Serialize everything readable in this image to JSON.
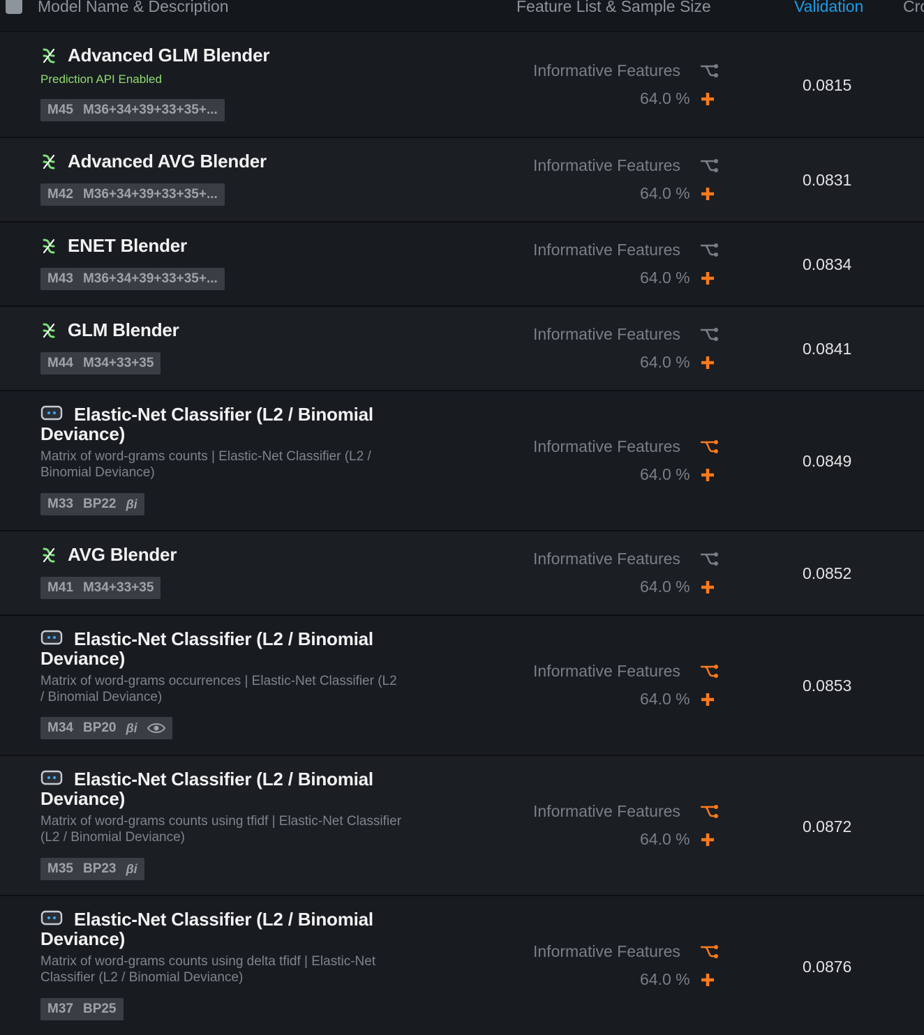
{
  "header": {
    "name_col": "Model Name & Description",
    "feature_col": "Feature List & Sample Size",
    "validation_col": "Validation",
    "cross_col": "Cro"
  },
  "colors": {
    "accent_blue": "#1e9be8",
    "accent_orange": "#ff7a1a",
    "api_green": "#8fdc6f",
    "blender_green": "#7ee07a"
  },
  "rows": [
    {
      "icon": "blender-icon",
      "title": "Advanced GLM Blender",
      "api": "Prediction API Enabled",
      "model_id": "M45",
      "blueprint": "M36+34+39+33+35+...",
      "feature_list": "Informative Features",
      "feature_icon_state": "gray",
      "sample": "64.0 %",
      "validation": "0.0815"
    },
    {
      "icon": "blender-icon",
      "title": "Advanced AVG Blender",
      "model_id": "M42",
      "blueprint": "M36+34+39+33+35+...",
      "feature_list": "Informative Features",
      "feature_icon_state": "gray",
      "sample": "64.0 %",
      "validation": "0.0831"
    },
    {
      "icon": "blender-icon",
      "title": "ENET Blender",
      "model_id": "M43",
      "blueprint": "M36+34+39+33+35+...",
      "feature_list": "Informative Features",
      "feature_icon_state": "gray",
      "sample": "64.0 %",
      "validation": "0.0834"
    },
    {
      "icon": "blender-icon",
      "title": "GLM Blender",
      "model_id": "M44",
      "blueprint": "M34+33+35",
      "feature_list": "Informative Features",
      "feature_icon_state": "gray",
      "sample": "64.0 %",
      "validation": "0.0841"
    },
    {
      "icon": "robot-icon",
      "title_line1": "Elastic-Net Classifier (L2 / Binomial",
      "title_line2": "Deviance)",
      "desc": "Matrix of word-grams counts | Elastic-Net Classifier (L2 / Binomial Deviance)",
      "model_id": "M33",
      "blueprint": "BP22",
      "beta": "βi",
      "feature_list": "Informative Features",
      "feature_icon_state": "orange",
      "sample": "64.0 %",
      "validation": "0.0849"
    },
    {
      "icon": "blender-icon",
      "title": "AVG Blender",
      "model_id": "M41",
      "blueprint": "M34+33+35",
      "feature_list": "Informative Features",
      "feature_icon_state": "gray",
      "sample": "64.0 %",
      "validation": "0.0852"
    },
    {
      "icon": "robot-icon",
      "title_line1": "Elastic-Net Classifier (L2 / Binomial",
      "title_line2": "Deviance)",
      "desc": "Matrix of word-grams occurrences | Elastic-Net Classifier (L2 / Binomial Deviance)",
      "model_id": "M34",
      "blueprint": "BP20",
      "beta": "βi",
      "feature_list": "Informative Features",
      "feature_icon_state": "orange",
      "sample": "64.0 %",
      "validation": "0.0853"
    },
    {
      "icon": "robot-icon",
      "title_line1": "Elastic-Net Classifier (L2 / Binomial",
      "title_line2": "Deviance)",
      "desc": "Matrix of word-grams counts using tfidf | Elastic-Net Classifier (L2 / Binomial Deviance)",
      "model_id": "M35",
      "blueprint": "BP23",
      "beta": "βi",
      "feature_list": "Informative Features",
      "feature_icon_state": "orange",
      "sample": "64.0 %",
      "validation": "0.0872"
    },
    {
      "icon": "robot-icon",
      "title_line1": "Elastic-Net Classifier (L2 / Binomial",
      "title_line2": "Deviance)",
      "desc": "Matrix of word-grams counts using delta tfidf | Elastic-Net Classifier (L2 / Binomial Deviance)",
      "model_id": "M37",
      "blueprint": "BP25",
      "feature_list": "Informative Features",
      "feature_icon_state": "orange",
      "sample": "64.0 %",
      "validation": "0.0876"
    }
  ]
}
